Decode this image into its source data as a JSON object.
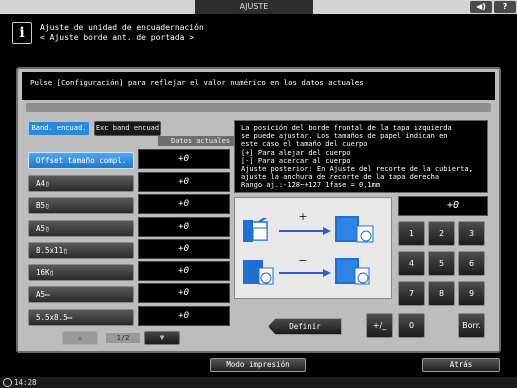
{
  "topbar": {
    "title": "AJUSTE",
    "volume_icon": "◀)",
    "help_icon": "?"
  },
  "header": {
    "line1": "Ajuste de unidad de encuadernación",
    "line2": "< Ajuste borde ant. de portada >"
  },
  "panel": {
    "message": "Pulse [Configuración] para reflejar el valor numérico en los datos actuales",
    "tabs": [
      "Band. encuad.",
      "Exc band encuad"
    ],
    "column_header": "Datos actuales",
    "rows": [
      {
        "label": "Offset tamaño compl.",
        "value": "+0"
      },
      {
        "label": "A4▯",
        "value": "+0"
      },
      {
        "label": "B5▯",
        "value": "+0"
      },
      {
        "label": "A5▯",
        "value": "+0"
      },
      {
        "label": "8.5x11▯",
        "value": "+0"
      },
      {
        "label": "16K▯",
        "value": "+0"
      },
      {
        "label": "A5▭",
        "value": "+0"
      },
      {
        "label": "5.5x8.5▭",
        "value": "+0"
      }
    ],
    "pager": {
      "up": "▲",
      "down": "▼",
      "page": "1/2"
    },
    "description": [
      "La posición del borde frontal de la tapa izquierda",
      "se puede ajustar. Los tamaños de papel indican en",
      "este caso el tamaño del cuerpo",
      "[+] Para alejar del cuerpo",
      "[-] Para acercar al cuerpo",
      "Ajuste posterior: En Ajuste del recorte de la cubierta,",
      "ajuste la anchura de recorte de la tapa derecha",
      "Rango aj.:-128~+127 1fase = 0,1mm"
    ],
    "diagram": {
      "plus": "+",
      "minus": "−"
    },
    "current_value": "+0",
    "keypad": [
      "1",
      "2",
      "3",
      "4",
      "5",
      "6",
      "7",
      "8",
      "9",
      "+/_",
      "0",
      "Borr."
    ],
    "define_button": "Definir"
  },
  "bottom": {
    "mode_button": "Modo impresión",
    "back_button": "Atrás"
  },
  "status": {
    "time": "14:28"
  },
  "colors": {
    "accent": "#2a88d8",
    "panel": "#bdbdbd",
    "diagram_blue": "#1f6fd0"
  }
}
